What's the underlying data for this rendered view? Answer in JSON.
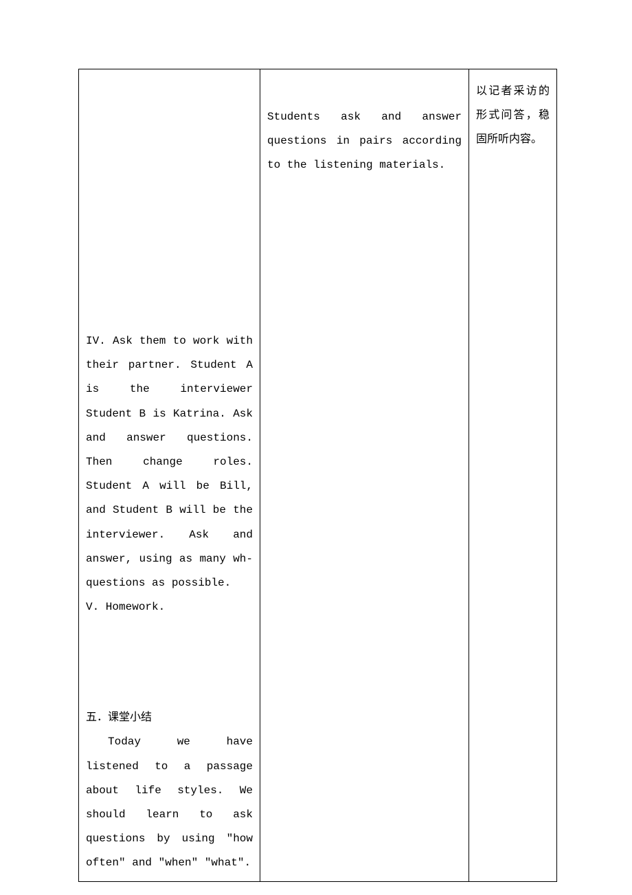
{
  "col1": {
    "section4": "IV. Ask them to work with their partner. Student A is the interviewer Student B is Katrina. Ask and answer questions. Then change  roles. Student A will be Bill, and  Student B will be the interviewer. Ask and answer, using as many wh-questions as possible.",
    "section5": "V. Homework.",
    "summary_title": "五．课堂小结",
    "summary_text": "Today we have listened to a passage about life styles. We should learn to ask questions by using \"how often\" and \"when\" \"what\"."
  },
  "col2": {
    "text": "Students ask and answer questions in pairs according to the listening materials."
  },
  "col3": {
    "text": "以记者采访的形式问答，稳固所听内容。"
  }
}
